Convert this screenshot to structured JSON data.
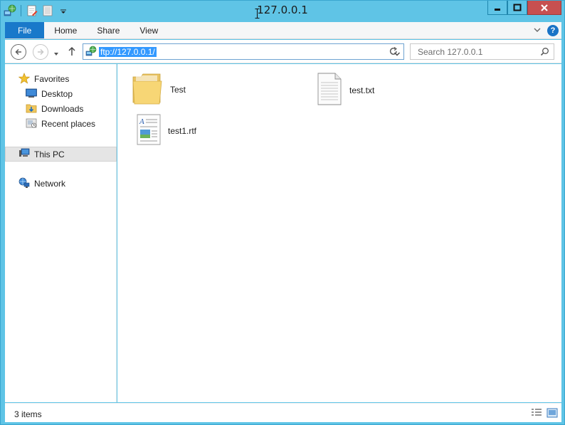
{
  "window": {
    "title": "127.0.0.1",
    "minimize_label": "Minimize",
    "maximize_label": "Maximize",
    "close_label": "Close"
  },
  "quick_access": {
    "icons": [
      "ftp-network-icon",
      "properties-icon",
      "new-folder-icon",
      "customize-toolbar-chevron-icon"
    ]
  },
  "ribbon": {
    "tabs": [
      {
        "label": "File"
      },
      {
        "label": "Home"
      },
      {
        "label": "Share"
      },
      {
        "label": "View"
      }
    ],
    "file_tab_color": "#1979ca"
  },
  "address_bar": {
    "value": "ftp://127.0.0.1/",
    "selection_color": "#3399ff"
  },
  "search": {
    "placeholder": "Search 127.0.0.1"
  },
  "nav_pane": {
    "favorites_label": "Favorites",
    "favorites": [
      {
        "label": "Desktop",
        "icon": "desktop-icon"
      },
      {
        "label": "Downloads",
        "icon": "downloads-icon"
      },
      {
        "label": "Recent places",
        "icon": "recent-places-icon"
      }
    ],
    "this_pc_label": "This PC",
    "network_label": "Network"
  },
  "files": [
    {
      "name": "Test",
      "type": "folder",
      "icon": "folder-icon"
    },
    {
      "name": "test.txt",
      "type": "text",
      "icon": "text-document-icon"
    },
    {
      "name": "test1.rtf",
      "type": "rtf",
      "icon": "rtf-document-icon"
    }
  ],
  "status_bar": {
    "item_count": "3 items"
  },
  "colors": {
    "frame": "#5fc4e6",
    "close_button": "#c75050",
    "accent": "#1979ca"
  }
}
